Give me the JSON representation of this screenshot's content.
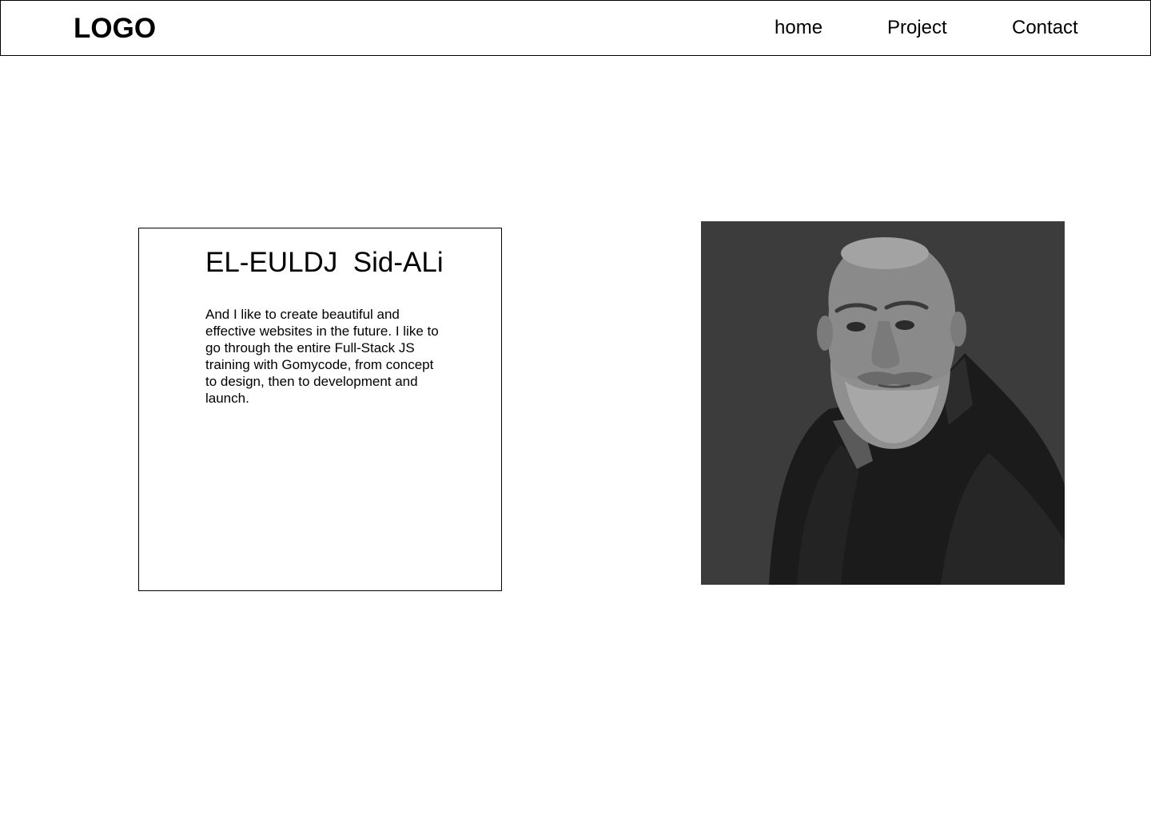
{
  "header": {
    "logo": "LOGO",
    "nav": [
      {
        "label": "home"
      },
      {
        "label": "Project"
      },
      {
        "label": "Contact"
      }
    ]
  },
  "profile": {
    "name": "EL-EULDJ  Sid-ALi",
    "bio": "And I like to create beautiful and effective websites in the future. I like to go through the entire Full-Stack JS training with Gomycode, from concept to design, then to development and launch."
  },
  "photo": {
    "subject": "portrait-photo",
    "background_color": "#3c3c3c"
  }
}
